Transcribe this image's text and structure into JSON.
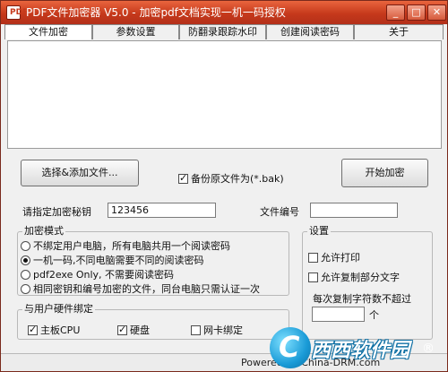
{
  "window": {
    "title": "PDF文件加密器 V5.0 - 加密pdf文档实现一机一码授权",
    "icon_label": "PDF",
    "controls": {
      "minimize": "_",
      "maximize": "□",
      "close": "✕"
    }
  },
  "tabs": [
    {
      "label": "文件加密"
    },
    {
      "label": "参数设置"
    },
    {
      "label": "防翻录跟踪水印"
    },
    {
      "label": "创建阅读密码"
    },
    {
      "label": "关于"
    }
  ],
  "actions": {
    "select_add": "选择&添加文件...",
    "backup": "备份原文件为(*.bak)",
    "start": "开始加密"
  },
  "key": {
    "label": "请指定加密秘钥",
    "value": "123456"
  },
  "file_number": {
    "label": "文件编号",
    "value": ""
  },
  "mode": {
    "title": "加密模式",
    "options": [
      "不绑定用户电脑，所有电脑共用一个阅读密码",
      "一机一码,不同电脑需要不同的阅读密码",
      "pdf2exe Only, 不需要阅读密码",
      "相同密钥和编号加密的文件，同台电脑只需认证一次"
    ],
    "selected": 1
  },
  "hardware": {
    "title": "与用户硬件绑定",
    "cpu": "主板CPU",
    "disk": "硬盘",
    "nic": "网卡绑定"
  },
  "settings": {
    "title": "设置",
    "allow_print": "允许打印",
    "allow_copy": "允许复制部分文字",
    "max_copy_label": "每次复制字符数不超过",
    "max_copy_value": "",
    "max_copy_unit": "个"
  },
  "status": {
    "text": "Powered by China-DRM.com"
  },
  "watermark": {
    "letter": "C",
    "text": "西西软件园",
    "suffix": "®"
  }
}
